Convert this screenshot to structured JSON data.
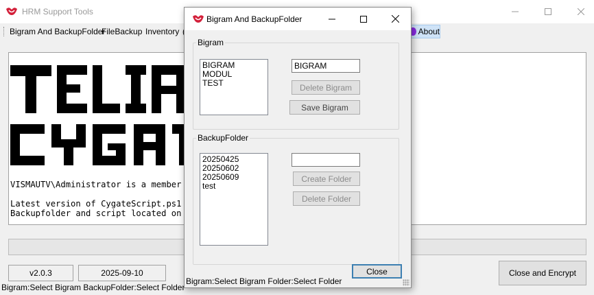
{
  "main": {
    "title": "HRM Support Tools",
    "menu": {
      "bigram": "Bigram And BackupFolder",
      "filebackup": "FileBackup",
      "inventory": "Inventory",
      "cut": "(",
      "about": "About"
    },
    "console": {
      "banner_lines": [
        "TELIA",
        "CYGAT"
      ],
      "line1": "VISMAUTV\\Administrator is a member o",
      "line2": "Latest version of CygateScript.ps1 r",
      "line3": "Backupfolder and script located on D"
    },
    "version": "v2.0.3",
    "date": "2025-09-10",
    "close_encrypt": "Close and Encrypt",
    "statusbar": "Bigram:Select Bigram BackupFolder:Select Folder"
  },
  "dialog": {
    "title": "Bigram And BackupFolder",
    "bigram_group": {
      "label": "Bigram",
      "items": [
        "BIGRAM",
        "MODUL",
        "TEST"
      ],
      "input_value": "BIGRAM",
      "delete_label": "Delete Bigram",
      "save_label": "Save Bigram"
    },
    "backup_group": {
      "label": "BackupFolder",
      "items": [
        "20250425",
        "20250602",
        "20250609",
        "test"
      ],
      "input_value": "",
      "create_label": "Create Folder",
      "delete_label": "Delete Folder"
    },
    "close_label": "Close",
    "statusbar": "Bigram:Select Bigram Folder:Select Folder"
  },
  "colors": {
    "brand_red": "#d3203a",
    "accent_blue": "#3c7fb1",
    "menu_highlight": "#cfe3f7",
    "about_icon": "#8a2be2"
  },
  "icons": {
    "app": "vismadesign-logo-icon",
    "about": "info-globe-icon"
  }
}
